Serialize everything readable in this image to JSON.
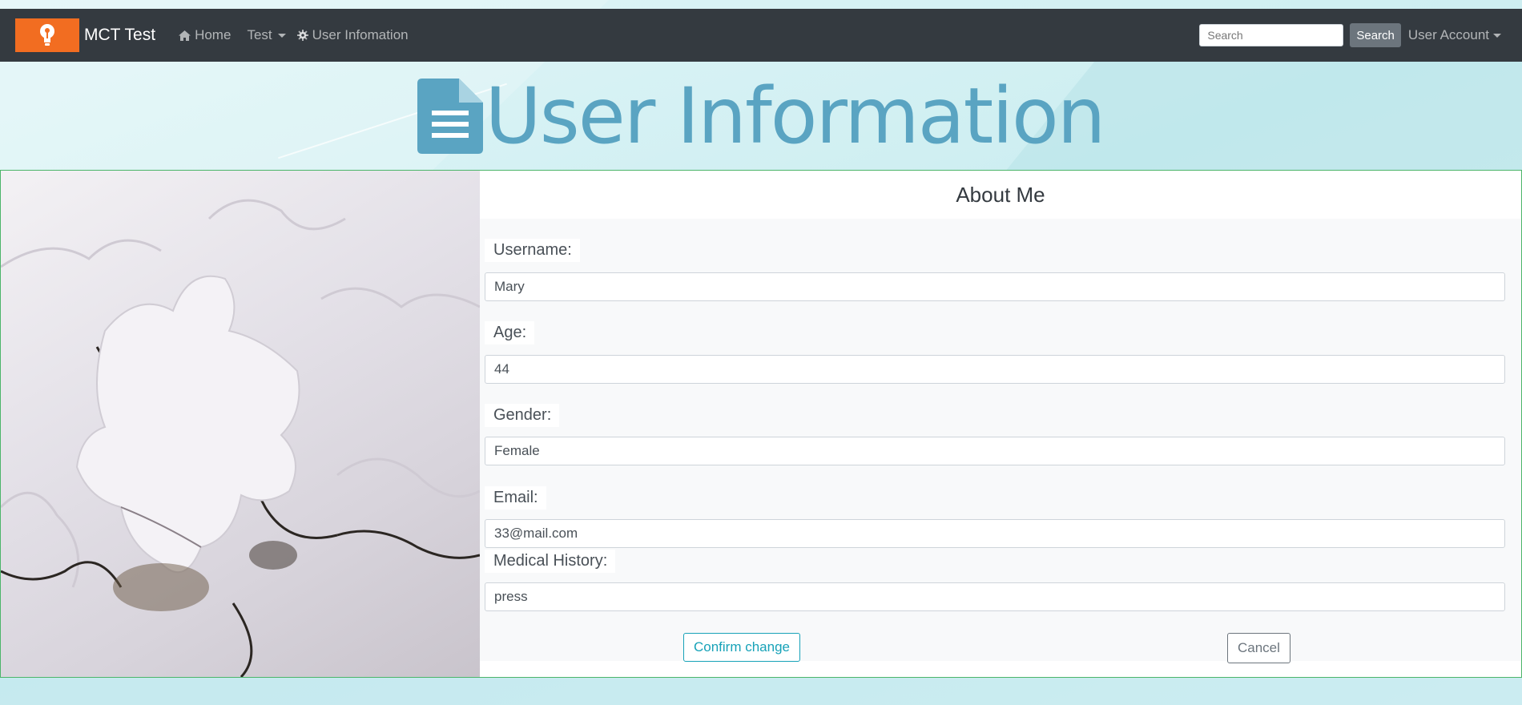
{
  "navbar": {
    "brand": "MCT Test",
    "home_label": "Home",
    "test_label": "Test",
    "info_label": "User Infomation",
    "search_placeholder": "Search",
    "search_button": "Search",
    "account_label": "User Account",
    "background_color": "#343a40",
    "logo_color": "#f26d21"
  },
  "hero": {
    "title": "User Information",
    "icon": "document-icon",
    "color": "#5aa4c2"
  },
  "card": {
    "title": "About Me",
    "image": "puzzle-pieces-photo",
    "fields": [
      {
        "label": "Username:",
        "value": "Mary"
      },
      {
        "label": "Age:",
        "value": "44"
      },
      {
        "label": "Gender:",
        "value": "Female"
      },
      {
        "label": "Email:",
        "value": "33@mail.com"
      },
      {
        "label": "Medical History:",
        "value": "press"
      }
    ],
    "confirm_button": "Confirm change",
    "cancel_button": "Cancel"
  }
}
